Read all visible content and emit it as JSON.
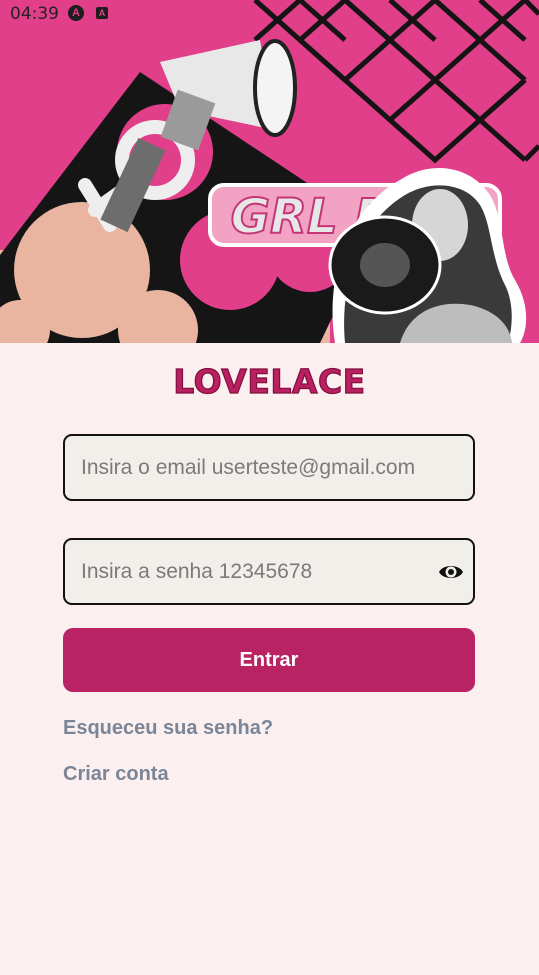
{
  "status_bar": {
    "time": "04:39",
    "icons": [
      "app-a-icon",
      "app-b-icon"
    ]
  },
  "hero": {
    "image": "grl-pwr-banner-image",
    "sticker_text": "GRL PWR"
  },
  "app": {
    "logo": "LOVELACE"
  },
  "form": {
    "email_placeholder": "Insira o email userteste@gmail.com",
    "password_placeholder": "Insira a senha 12345678",
    "password_toggle_icon": "eye-icon",
    "submit_label": "Entrar",
    "forgot_password": "Esqueceu sua senha?",
    "create_account": "Criar conta"
  },
  "colors": {
    "primary": "#b92363",
    "hero_pink": "#e23f8a",
    "background": "#fcefef",
    "link": "#7a8698"
  }
}
